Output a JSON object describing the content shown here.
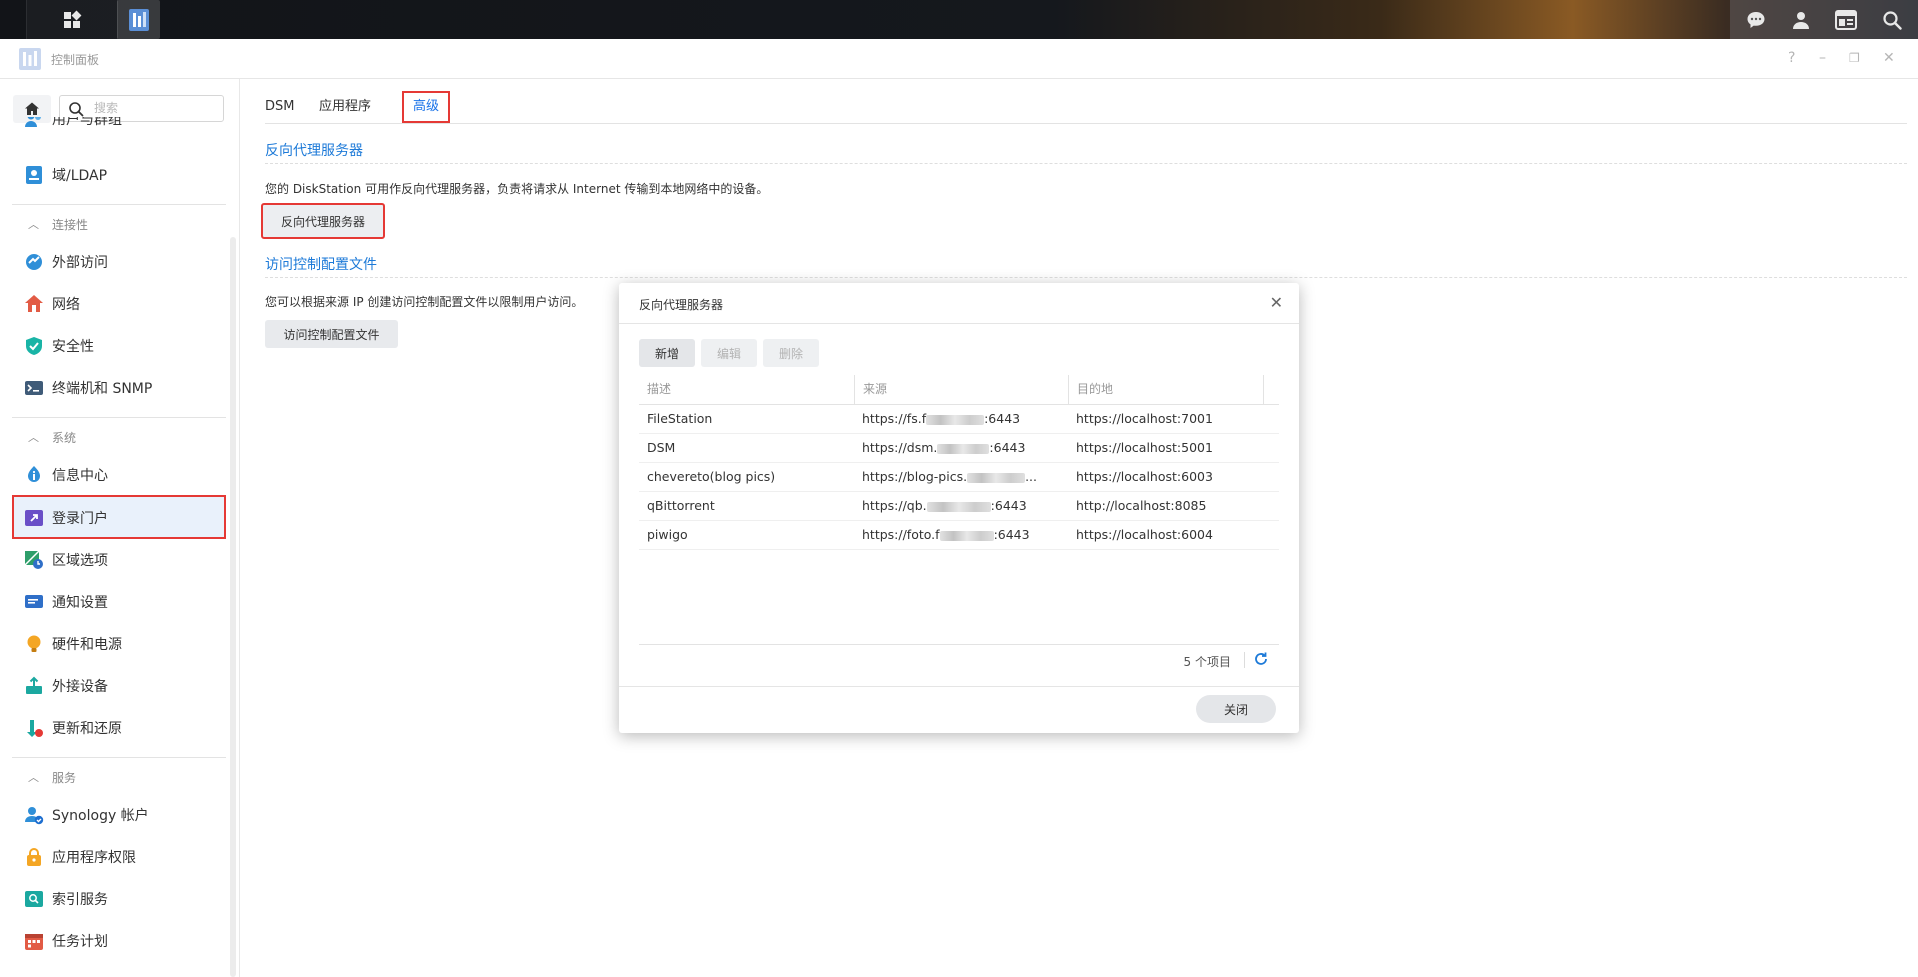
{
  "window": {
    "title": "控制面板",
    "help": "?",
    "minimize": "–",
    "restore": "❐",
    "close": "✕"
  },
  "sidebar": {
    "search_placeholder": "搜索",
    "top_items": [
      {
        "label": "用户与群组",
        "icon": "users-icon"
      },
      {
        "label": "域/LDAP",
        "icon": "domain-ldap-icon"
      }
    ],
    "sections": [
      {
        "label": "连接性",
        "items": [
          {
            "label": "外部访问",
            "icon": "external-access-icon"
          },
          {
            "label": "网络",
            "icon": "network-icon"
          },
          {
            "label": "安全性",
            "icon": "security-shield-icon"
          },
          {
            "label": "终端机和 SNMP",
            "icon": "terminal-icon"
          }
        ]
      },
      {
        "label": "系统",
        "items": [
          {
            "label": "信息中心",
            "icon": "info-center-icon"
          },
          {
            "label": "登录门户",
            "icon": "login-portal-icon",
            "selected": true
          },
          {
            "label": "区域选项",
            "icon": "regional-options-icon"
          },
          {
            "label": "通知设置",
            "icon": "notification-icon"
          },
          {
            "label": "硬件和电源",
            "icon": "hardware-power-icon"
          },
          {
            "label": "外接设备",
            "icon": "external-devices-icon"
          },
          {
            "label": "更新和还原",
            "icon": "update-restore-icon"
          }
        ]
      },
      {
        "label": "服务",
        "items": [
          {
            "label": "Synology 帐户",
            "icon": "synology-account-icon"
          },
          {
            "label": "应用程序权限",
            "icon": "app-privileges-icon"
          },
          {
            "label": "索引服务",
            "icon": "indexing-service-icon"
          },
          {
            "label": "任务计划",
            "icon": "task-scheduler-icon"
          }
        ]
      }
    ]
  },
  "tabs": [
    {
      "label": "DSM"
    },
    {
      "label": "应用程序"
    },
    {
      "label": "高级",
      "active": true
    }
  ],
  "reverse_proxy": {
    "title": "反向代理服务器",
    "description": "您的 DiskStation 可用作反向代理服务器，负责将请求从 Internet 传输到本地网络中的设备。",
    "button": "反向代理服务器"
  },
  "access_control": {
    "title": "访问控制配置文件",
    "description": "您可以根据来源 IP 创建访问控制配置文件以限制用户访问。",
    "button": "访问控制配置文件"
  },
  "dialog": {
    "title": "反向代理服务器",
    "buttons": {
      "add": "新增",
      "edit": "编辑",
      "delete": "删除"
    },
    "columns": [
      "描述",
      "来源",
      "目的地"
    ],
    "rows": [
      {
        "desc": "FileStation",
        "src_prefix": "https://fs.f",
        "src_suffix": ":6443",
        "dest": "https://localhost:7001"
      },
      {
        "desc": "DSM",
        "src_prefix": "https://dsm.",
        "src_suffix": ":6443",
        "dest": "https://localhost:5001"
      },
      {
        "desc": "chevereto(blog pics)",
        "src_prefix": "https://blog-pics.",
        "src_suffix": "...",
        "dest": "https://localhost:6003"
      },
      {
        "desc": "qBittorrent",
        "src_prefix": "https://qb.",
        "src_suffix": ":6443",
        "dest": "http://localhost:8085"
      },
      {
        "desc": "piwigo",
        "src_prefix": "https://foto.f",
        "src_suffix": ":6443",
        "dest": "https://localhost:6004"
      }
    ],
    "count": "5 个项目",
    "close": "关闭"
  }
}
